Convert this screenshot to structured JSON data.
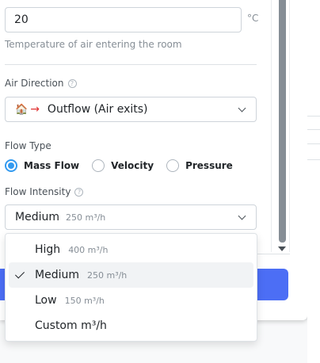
{
  "temperature": {
    "value": "20",
    "unit": "°C",
    "hint": "Temperature of air entering the room"
  },
  "air_direction": {
    "label": "Air Direction",
    "help": "?",
    "house_glyph": "🏠",
    "arrow_glyph": "→",
    "selected": "Outflow (Air exits)"
  },
  "flow_type": {
    "label": "Flow Type",
    "options": [
      {
        "label": "Mass Flow",
        "checked": true
      },
      {
        "label": "Velocity",
        "checked": false
      },
      {
        "label": "Pressure",
        "checked": false
      }
    ]
  },
  "flow_intensity": {
    "label": "Flow Intensity",
    "help": "?",
    "selected_value": "Medium",
    "selected_sub": "250 m³/h",
    "options": [
      {
        "label": "High",
        "sub": "400 m³/h",
        "selected": false
      },
      {
        "label": "Medium",
        "sub": "250 m³/h",
        "selected": true
      },
      {
        "label": "Low",
        "sub": "150 m³/h",
        "selected": false
      },
      {
        "label": "Custom m³/h",
        "sub": "",
        "selected": false
      }
    ]
  },
  "colors": {
    "accent": "#339af0",
    "button": "#4c6ef5",
    "arrow": "#e03131"
  }
}
